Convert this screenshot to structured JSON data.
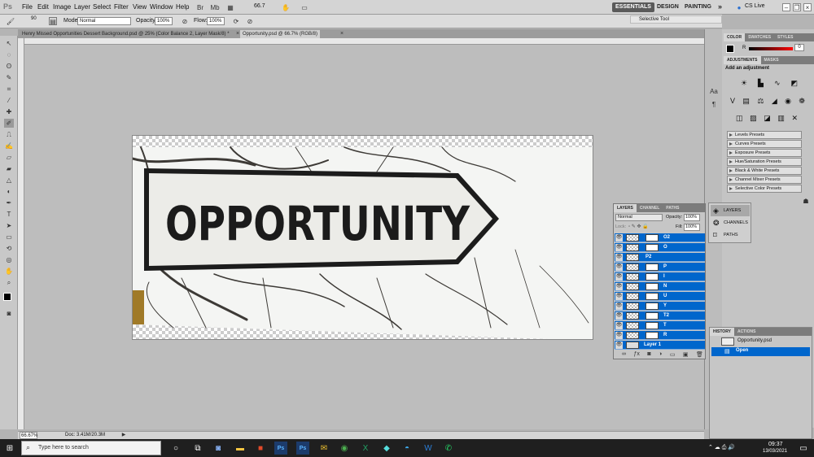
{
  "app": {
    "logo": "Ps"
  },
  "menu": [
    "File",
    "Edit",
    "Image",
    "Layer",
    "Select",
    "Filter",
    "View",
    "Window",
    "Help"
  ],
  "zoom_menu": "66.7",
  "workspace": {
    "items": [
      "ESSENTIALS",
      "DESIGN",
      "PAINTING"
    ],
    "more": "»",
    "cslive": "CS Live"
  },
  "options": {
    "brush_size": "90",
    "mode_label": "Mode:",
    "mode_value": "Normal",
    "opacity_label": "Opacity:",
    "opacity_value": "100%",
    "flow_label": "Flow:",
    "flow_value": "100%"
  },
  "tooltip": "Selective Tool",
  "doc_tabs": [
    {
      "label": "Henry Missed Opportunities Dessert Background.psd @ 25% (Color Balance 2, Layer Mask/8) *"
    },
    {
      "label": "Opportunity.psd @ 66.7% (RGB/8)"
    }
  ],
  "canvas": {
    "sign_text": "OPPORTUNITY"
  },
  "status": {
    "zoom": "66.67%",
    "doc": "Doc: 3.41M/20.3M"
  },
  "color_panel": {
    "tabs": [
      "COLOR",
      "SWATCHES",
      "STYLES"
    ],
    "channel": "R",
    "value": "0"
  },
  "adjustments": {
    "tabs": [
      "ADJUSTMENTS",
      "MASKS"
    ],
    "heading": "Add an adjustment",
    "presets": [
      "Levels Presets",
      "Curves Presets",
      "Exposure Presets",
      "Hue/Saturation Presets",
      "Black & White Presets",
      "Channel Mixer Presets",
      "Selective Color Presets"
    ]
  },
  "layers_panel": {
    "tabs": [
      "LAYERS",
      "CHANNEL",
      "PATHS"
    ],
    "blend_mode": "Normal",
    "opacity_label": "Opacity:",
    "opacity_value": "100%",
    "lock_label": "Lock:",
    "fill_label": "Fill:",
    "fill_value": "100%",
    "layers": [
      "O2",
      "O",
      "P2",
      "P",
      "I",
      "N",
      "U",
      "Y",
      "T2",
      "T",
      "R",
      "Layer 1"
    ]
  },
  "flyout": {
    "items": [
      "LAYERS",
      "CHANNELS",
      "PATHS"
    ]
  },
  "history_panel": {
    "tabs": [
      "HISTORY",
      "ACTIONS"
    ],
    "snapshot": "Opportunity.psd",
    "state": "Open"
  },
  "taskbar": {
    "search_placeholder": "Type here to search",
    "time": "09:37",
    "date": "13/03/2021"
  }
}
